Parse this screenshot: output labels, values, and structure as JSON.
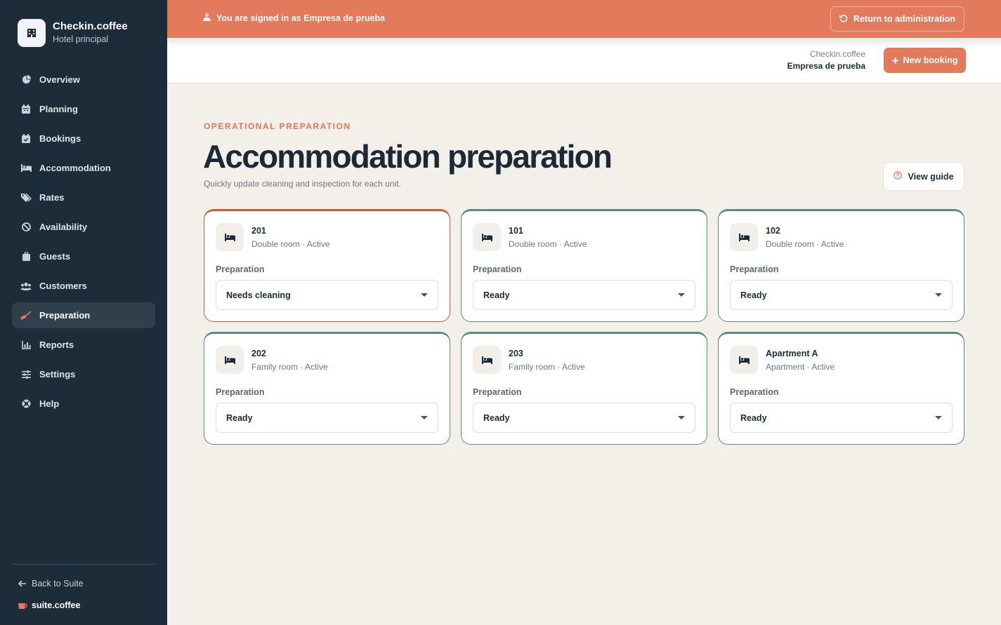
{
  "brand": {
    "name": "Checkin.coffee",
    "subtitle": "Hotel principal"
  },
  "sidebar": {
    "items": [
      {
        "label": "Overview",
        "icon": "pie-chart-icon"
      },
      {
        "label": "Planning",
        "icon": "calendar-icon"
      },
      {
        "label": "Bookings",
        "icon": "calendar-check-icon"
      },
      {
        "label": "Accommodation",
        "icon": "bed-icon"
      },
      {
        "label": "Rates",
        "icon": "tags-icon"
      },
      {
        "label": "Availability",
        "icon": "ban-icon"
      },
      {
        "label": "Guests",
        "icon": "suitcase-icon"
      },
      {
        "label": "Customers",
        "icon": "users-icon"
      },
      {
        "label": "Preparation",
        "icon": "broom-icon",
        "active": true
      },
      {
        "label": "Reports",
        "icon": "bar-chart-icon"
      },
      {
        "label": "Settings",
        "icon": "sliders-icon"
      },
      {
        "label": "Help",
        "icon": "life-ring-icon"
      }
    ],
    "back_label": "Back to Suite",
    "suite_label": "suite.coffee"
  },
  "banner": {
    "text": "You are signed in as Empresa de prueba",
    "return_label": "Return to administration"
  },
  "topbar": {
    "app_name": "Checkin.coffee",
    "org_name": "Empresa de prueba",
    "new_booking_label": "New booking"
  },
  "page": {
    "eyebrow": "OPERATIONAL PREPARATION",
    "title": "Accommodation preparation",
    "subtitle": "Quickly update cleaning and inspection for each unit.",
    "guide_label": "View guide"
  },
  "units": [
    {
      "name": "201",
      "meta": "Double room · Active",
      "prep_label": "Preparation",
      "status": "Needs cleaning",
      "state": "warn"
    },
    {
      "name": "101",
      "meta": "Double room · Active",
      "prep_label": "Preparation",
      "status": "Ready",
      "state": "ok"
    },
    {
      "name": "102",
      "meta": "Double room · Active",
      "prep_label": "Preparation",
      "status": "Ready",
      "state": "ok"
    },
    {
      "name": "202",
      "meta": "Family room · Active",
      "prep_label": "Preparation",
      "status": "Ready",
      "state": "ok"
    },
    {
      "name": "203",
      "meta": "Family room · Active",
      "prep_label": "Preparation",
      "status": "Ready",
      "state": "ok"
    },
    {
      "name": "Apartment A",
      "meta": "Apartment · Active",
      "prep_label": "Preparation",
      "status": "Ready",
      "state": "ok"
    }
  ],
  "colors": {
    "accent": "#e47a5c",
    "sidebar": "#1c2c38",
    "ready_border": "#5b8a80",
    "warn_border": "#cf5a43",
    "background": "#f3f0ea"
  }
}
